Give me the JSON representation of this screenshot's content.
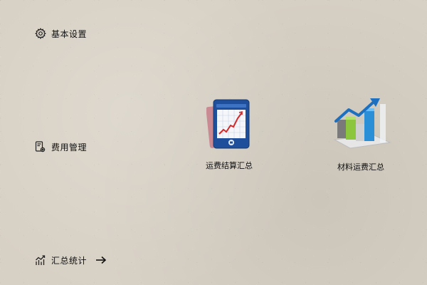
{
  "sidebar": {
    "items": [
      {
        "label": "基本设置",
        "icon": "gear-icon"
      },
      {
        "label": "费用管理",
        "icon": "document-settings-icon"
      },
      {
        "label": "汇总统计",
        "icon": "trend-chart-icon",
        "trailing_icon": "arrow-right-icon"
      }
    ]
  },
  "main": {
    "tiles": [
      {
        "label": "运费结算汇总",
        "icon": "report-chart-icon"
      },
      {
        "label": "材料运费汇总",
        "icon": "bar-chart-growth-icon"
      }
    ]
  },
  "colors": {
    "background": "#d7d0c4",
    "text": "#111111",
    "report_blue": "#1f4f9a",
    "bar_green": "#8cc63f",
    "bar_blue": "#2a8fd6",
    "arrow_blue": "#1d6fbf"
  }
}
